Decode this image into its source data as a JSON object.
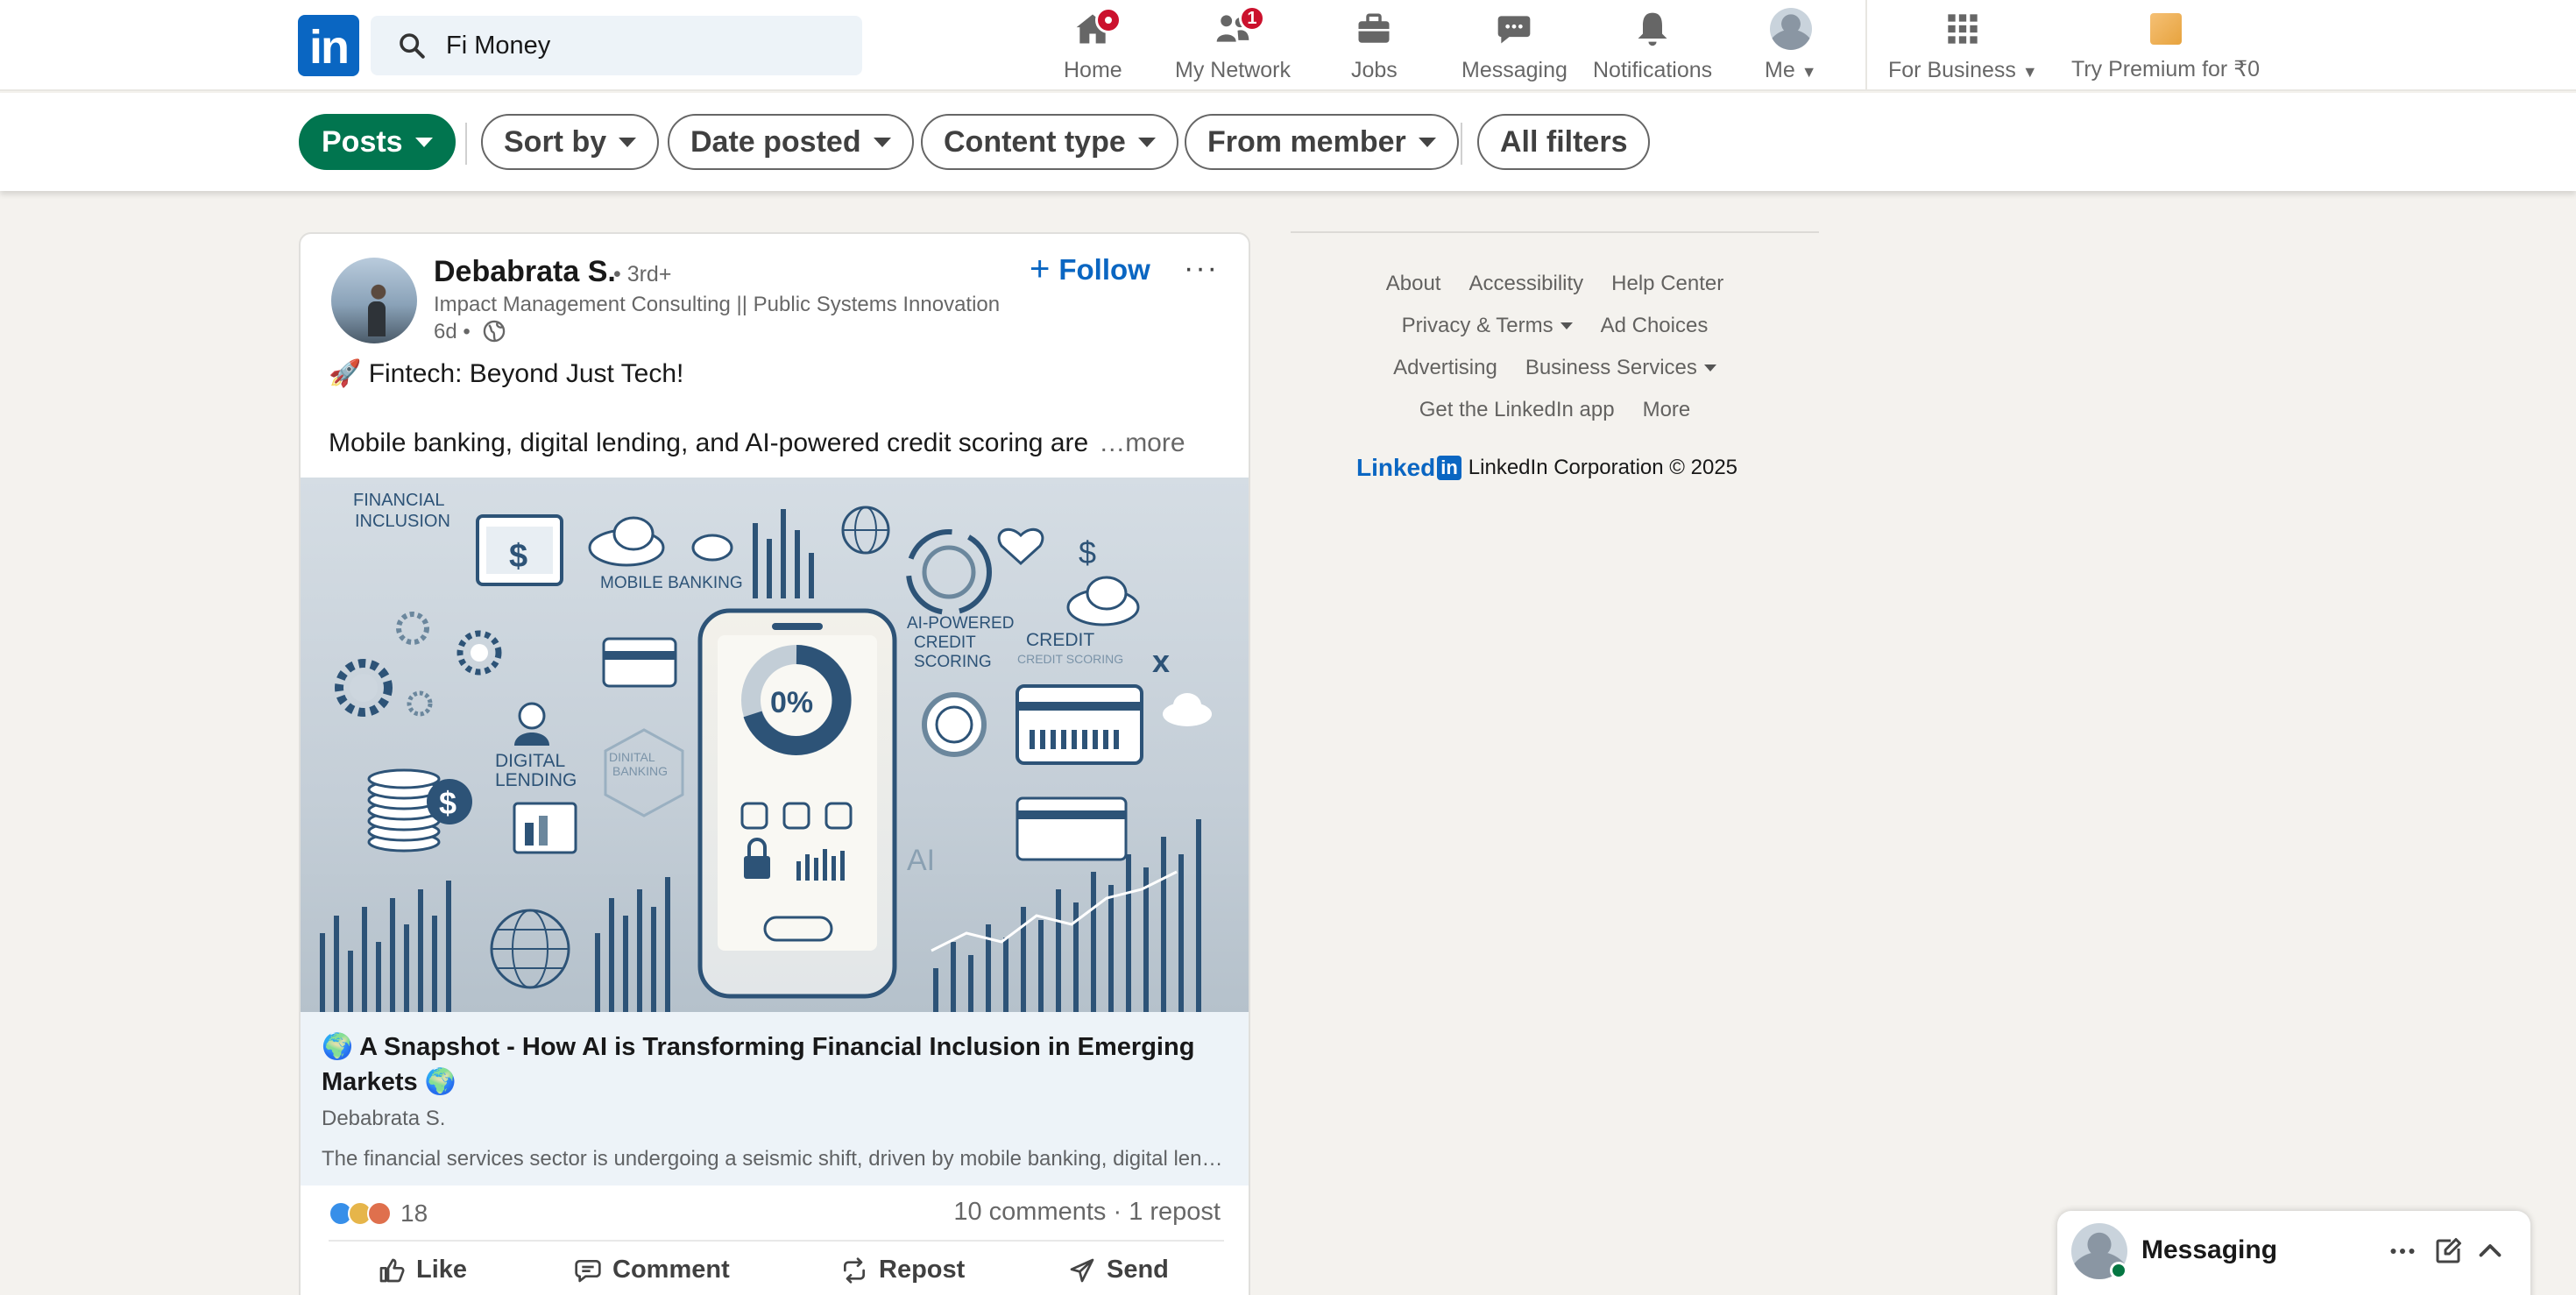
{
  "nav": {
    "search_value": "Fi Money",
    "items": [
      {
        "label": "Home",
        "icon": "home-icon"
      },
      {
        "label": "My Network",
        "icon": "people-icon",
        "badge": "1"
      },
      {
        "label": "Jobs",
        "icon": "briefcase-icon"
      },
      {
        "label": "Messaging",
        "icon": "chat-icon"
      },
      {
        "label": "Notifications",
        "icon": "bell-icon"
      },
      {
        "label": "Me",
        "icon": "avatar"
      },
      {
        "label": "For Business",
        "icon": "grid-icon"
      },
      {
        "label": "Try Premium for ₹0",
        "icon": "premium-icon"
      }
    ],
    "brand_color": "#0a66c2"
  },
  "filters": {
    "items": [
      {
        "label": "Posts",
        "active": true
      },
      {
        "label": "Sort by"
      },
      {
        "label": "Date posted"
      },
      {
        "label": "Content type"
      },
      {
        "label": "From member"
      },
      {
        "label": "All filters"
      }
    ],
    "active_color": "#01754f"
  },
  "post": {
    "author": "Debabrata S.",
    "degree": "• 3rd+",
    "headline": "Impact Management Consulting || Public Systems Innovation",
    "time": "6d •",
    "follow_label": "Follow",
    "body_line1": "🚀 Fintech: Beyond Just Tech!",
    "body_line2": "Mobile banking, digital lending, and AI-powered credit scoring are",
    "see_more": "…more",
    "image_labels": {
      "financial_inclusion_1": "FINANCIAL",
      "financial_inclusion_2": "INCLUSION",
      "mobile_banking": "MOBILE BANKING",
      "ai_1": "AI-POWERED",
      "ai_2": "CREDIT",
      "ai_3": "SCORING",
      "credit_1": "CREDIT",
      "credit_2": "CREDIT SCORING",
      "digital_lending_1": "DIGITAL",
      "digital_lending_2": "LENDING",
      "digital_banking_1": "DINITAL",
      "digital_banking_2": "BANKING",
      "percent": "0%",
      "ai_short": "AI"
    },
    "article": {
      "title": "🌍 A Snapshot - How AI is Transforming Financial Inclusion in Emerging Markets 🌍",
      "author": "Debabrata S.",
      "description": "The financial services sector is undergoing a seismic shift, driven by mobile banking, digital lending, and AI"
    },
    "reaction_count": "18",
    "comments_reposts": "10 comments · 1 repost",
    "actions": [
      "Like",
      "Comment",
      "Repost",
      "Send"
    ]
  },
  "footer": {
    "rows": [
      [
        "About",
        "Accessibility",
        "Help Center"
      ],
      [
        "Privacy & Terms",
        "Ad Choices"
      ],
      [
        "Advertising",
        "Business Services"
      ],
      [
        "Get the LinkedIn app",
        "More"
      ]
    ],
    "logo_text_1": "Linked",
    "logo_text_2": "in",
    "copyright": "LinkedIn Corporation © 2025"
  },
  "messaging": {
    "title": "Messaging"
  }
}
